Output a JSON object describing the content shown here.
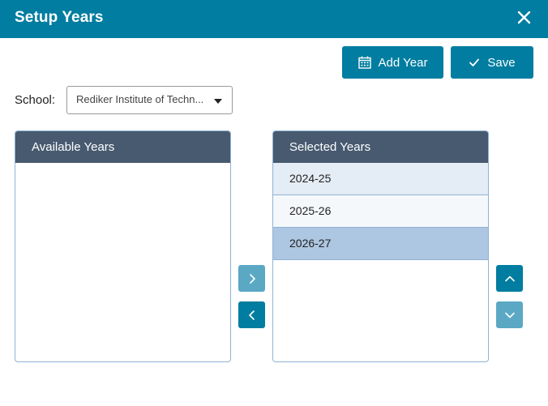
{
  "dialog": {
    "title": "Setup Years"
  },
  "toolbar": {
    "add_year_label": "Add Year",
    "save_label": "Save"
  },
  "school": {
    "label": "School:",
    "selected": "Rediker Institute of Techn..."
  },
  "available_years": {
    "header": "Available Years",
    "items": []
  },
  "selected_years": {
    "header": "Selected Years",
    "items": [
      "2024-25",
      "2025-26",
      "2026-27"
    ]
  },
  "colors": {
    "primary": "#007da0",
    "primary_light": "#5ba8c4",
    "panel_header": "#475a70",
    "row_highlight": "#adc6e1"
  },
  "icons": {
    "close": "close-icon",
    "add_year": "calendar-icon",
    "save": "checkmark-icon",
    "move_right": "chevron-right-icon",
    "move_left": "chevron-left-icon",
    "move_up": "chevron-up-icon",
    "move_down": "chevron-down-icon"
  }
}
